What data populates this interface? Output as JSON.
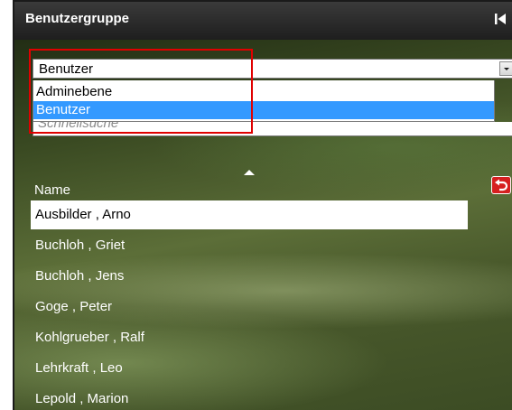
{
  "panel": {
    "title": "Benutzergruppe"
  },
  "group_select": {
    "selected_value": "Benutzer",
    "options": [
      {
        "label": "Adminebene",
        "highlighted": false
      },
      {
        "label": "Benutzer",
        "highlighted": true
      }
    ]
  },
  "search": {
    "placeholder": "Schnellsuche"
  },
  "table": {
    "column_header": "Name",
    "sort": "ascending",
    "rows": [
      {
        "name": "Ausbilder , Arno",
        "selected": true
      },
      {
        "name": "Buchloh , Griet",
        "selected": false
      },
      {
        "name": "Buchloh , Jens",
        "selected": false
      },
      {
        "name": "Goge , Peter",
        "selected": false
      },
      {
        "name": "Kohlgrueber , Ralf",
        "selected": false
      },
      {
        "name": "Lehrkraft , Leo",
        "selected": false
      },
      {
        "name": "Lepold , Marion",
        "selected": false
      }
    ]
  },
  "icons": {
    "collapse": "collapse-left-icon",
    "dropdown": "chevron-down-icon",
    "sort": "sort-ascending-icon",
    "reset": "undo-icon"
  },
  "colors": {
    "titlebar": "#2a2a2a",
    "option_highlight": "#3399ff",
    "annotation_box": "#e00000",
    "reset_button": "#d62020"
  }
}
